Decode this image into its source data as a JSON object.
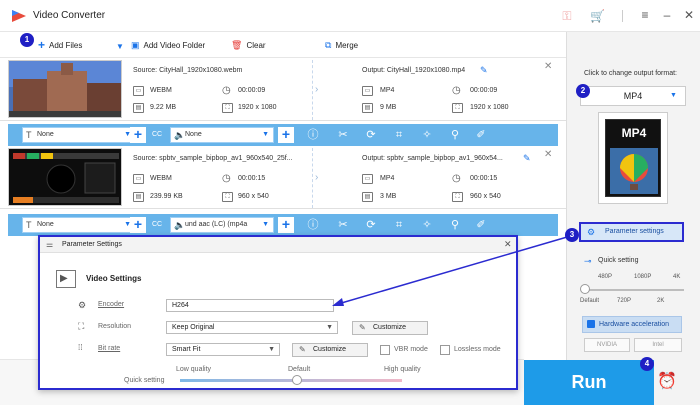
{
  "app": {
    "title": "Video Converter"
  },
  "toolbar": {
    "add_files": "Add Files",
    "add_folder": "Add Video Folder",
    "clear": "Clear",
    "merge": "Merge"
  },
  "files": [
    {
      "source": "Source: CityHall_1920x1080.webm",
      "output": "Output: CityHall_1920x1080.mp4",
      "src_format": "WEBM",
      "src_duration": "00:00:09",
      "src_size": "9.22 MB",
      "src_resolution": "1920 x 1080",
      "out_format": "MP4",
      "out_duration": "00:00:09",
      "out_size": "9 MB",
      "out_resolution": "1920 x 1080",
      "subtitle": "None",
      "audio": "None"
    },
    {
      "source": "Source: spbtv_sample_bipbop_av1_960x540_25f...",
      "output": "Output: spbtv_sample_bipbop_av1_960x54...",
      "src_format": "WEBM",
      "src_duration": "00:00:15",
      "src_size": "239.99 KB",
      "src_resolution": "960 x 540",
      "out_format": "MP4",
      "out_duration": "00:00:15",
      "out_size": "3 MB",
      "out_resolution": "960 x 540",
      "subtitle": "None",
      "audio": "und aac (LC) (mp4a"
    }
  ],
  "right_panel": {
    "hint": "Click to change output format:",
    "format": "MP4",
    "tile_label": "MP4",
    "param_settings": "Parameter settings",
    "quick_setting": "Quick setting",
    "ticks_top": [
      "480P",
      "1080P",
      "4K"
    ],
    "ticks_bottom": [
      "Default",
      "720P",
      "2K"
    ],
    "hw_accel": "Hardware acceleration",
    "vendor_1": "NVIDIA",
    "vendor_2": "Intel",
    "run": "Run"
  },
  "dialog": {
    "title": "Parameter Settings",
    "section": "Video Settings",
    "encoder_label": "Encoder",
    "encoder_value": "H264",
    "resolution_label": "Resolution",
    "resolution_value": "Keep Original",
    "customize_1": "Customize",
    "bitrate_label": "Bit rate",
    "bitrate_value": "Smart Fit",
    "customize_2": "Customize",
    "vbr": "VBR mode",
    "lossless": "Lossless mode",
    "quick_setting": "Quick setting",
    "low": "Low quality",
    "default": "Default",
    "high": "High quality"
  },
  "callouts": [
    "1",
    "2",
    "3",
    "4"
  ],
  "colors": {
    "accent": "#1e9be8",
    "edit_bar": "#67b4ea",
    "callout": "#1f1fc4"
  }
}
